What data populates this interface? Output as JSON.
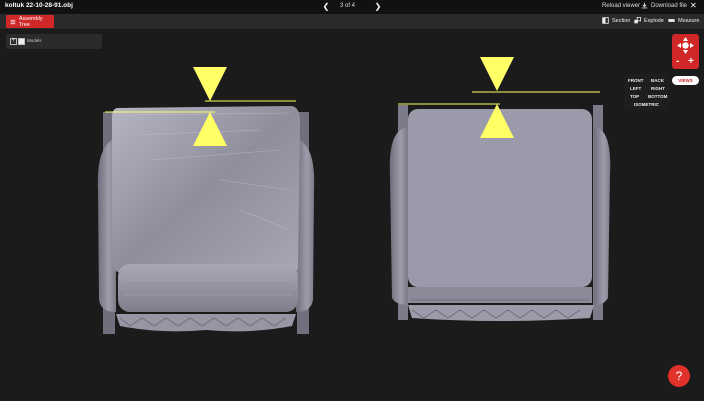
{
  "header": {
    "file_title": "koltuk 22-10-28-91.obj",
    "pager": "3 of 4",
    "reload_label": "Reload viewer",
    "download_label": "Download file"
  },
  "toolbar": {
    "assembly_label": "Assembly Tree",
    "section_label": "Section",
    "explode_label": "Explode",
    "measure_label": "Measure"
  },
  "tree": {
    "root_label": "Models"
  },
  "views": {
    "button_label": "VIEWS",
    "front": "FRONT",
    "back": "BACK",
    "left": "LEFT",
    "right": "RIGHT",
    "top": "TOP",
    "bottom": "BOTTOM",
    "isometric": "ISOMETRIC"
  },
  "zoom": {
    "minus": "-",
    "plus": "+"
  },
  "colors": {
    "accent": "#d02828",
    "marker": "#ffff66",
    "model": "#9c9cab"
  }
}
